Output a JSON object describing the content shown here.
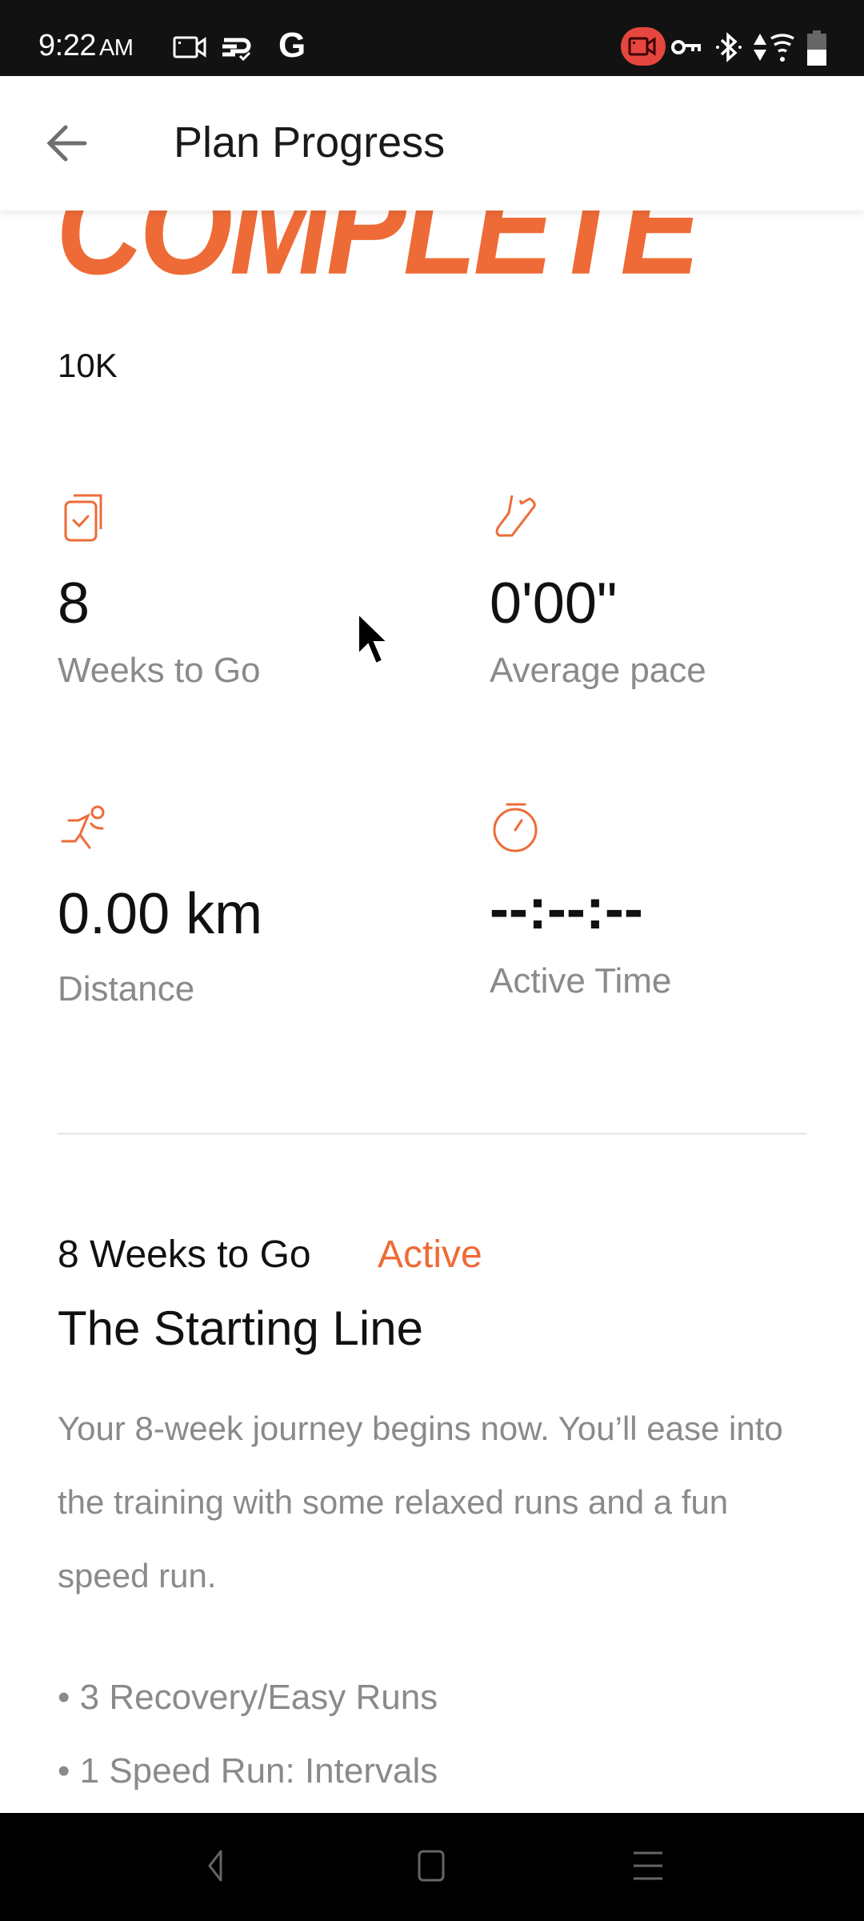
{
  "status_bar": {
    "time": "9:22",
    "ampm": "AM",
    "left_icons": [
      "screen-record-icon",
      "sync-icon",
      "google-icon"
    ],
    "right_icons": [
      "recording-active-icon",
      "vpn-key-icon",
      "bluetooth-icon",
      "data-arrows-icon",
      "wifi-icon",
      "battery-icon"
    ],
    "google_glyph": "G"
  },
  "app_bar": {
    "back_icon": "arrow-back-icon",
    "title": "Plan Progress"
  },
  "hero": {
    "banner_text": "COMPLETE",
    "plan_name": "10K",
    "accent_color": "#ee6b37"
  },
  "stats": [
    {
      "icon": "checklist-icon",
      "value": "8",
      "label": "Weeks to Go"
    },
    {
      "icon": "shoe-icon",
      "value": "0'00\"",
      "label": "Average pace"
    },
    {
      "icon": "runner-icon",
      "value": "0.00 km",
      "label": "Distance"
    },
    {
      "icon": "stopwatch-icon",
      "value": "--:--:--",
      "label": "Active Time"
    }
  ],
  "week": {
    "heading": "8 Weeks to Go",
    "status": "Active",
    "title": "The Starting Line",
    "description": "Your 8-week journey begins now. You’ll ease into the training with some relaxed runs and a fun speed run.",
    "workouts": [
      "3 Recovery/Easy Runs",
      "1 Speed Run: Intervals"
    ]
  },
  "nav_bar": {
    "buttons": [
      "nav-back-icon",
      "nav-home-icon",
      "nav-recents-icon"
    ]
  }
}
